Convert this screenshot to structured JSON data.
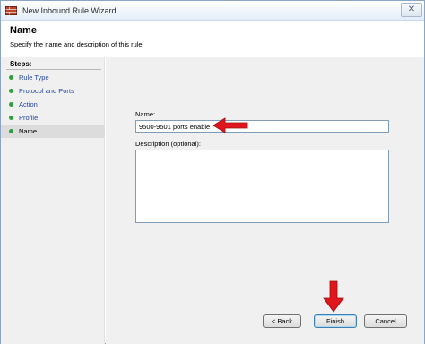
{
  "window": {
    "title": "New Inbound Rule Wizard"
  },
  "header": {
    "title": "Name",
    "description": "Specify the name and description of this rule."
  },
  "steps": {
    "title": "Steps:",
    "items": [
      {
        "label": "Rule Type",
        "state": "done"
      },
      {
        "label": "Protocol and Ports",
        "state": "done"
      },
      {
        "label": "Action",
        "state": "done"
      },
      {
        "label": "Profile",
        "state": "done"
      },
      {
        "label": "Name",
        "state": "current"
      }
    ]
  },
  "form": {
    "name_label": "Name:",
    "name_value": "9500-9501 ports enable",
    "description_label": "Description (optional):",
    "description_value": ""
  },
  "buttons": {
    "back": "< Back",
    "finish": "Finish",
    "cancel": "Cancel"
  },
  "colors": {
    "annotation_arrow": "#e0161d",
    "step_bullet": "#2f9e3e",
    "step_link": "#2447a8"
  },
  "icons": {
    "app": "firewall-wizard-icon",
    "close": "close-icon",
    "step": "green-bullet-icon",
    "annotation": "red-arrow-icon"
  }
}
